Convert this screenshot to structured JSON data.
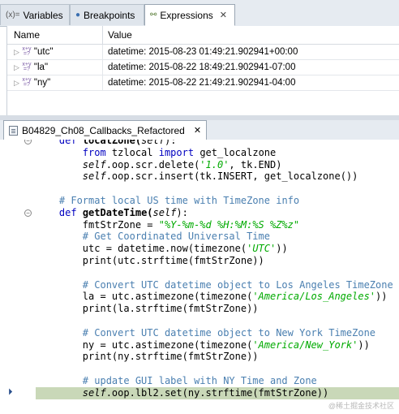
{
  "tabs": [
    {
      "icon": "variables-icon",
      "icon_text": "(x)=",
      "label": "Variables",
      "active": false
    },
    {
      "icon": "breakpoints-icon",
      "icon_text": "●",
      "label": "Breakpoints",
      "active": false
    },
    {
      "icon": "expressions-icon",
      "icon_text": "⚯",
      "label": "Expressions",
      "active": true,
      "close": "✕"
    }
  ],
  "expressions": {
    "columns": {
      "name": "Name",
      "value": "Value"
    },
    "rows": [
      {
        "name": "\"utc\"",
        "value": "datetime: 2015-08-23 01:49:21.902941+00:00"
      },
      {
        "name": "\"la\"",
        "value": "datetime: 2015-08-22 18:49:21.902941-07:00"
      },
      {
        "name": "\"ny\"",
        "value": "datetime: 2015-08-22 21:49:21.902941-04:00"
      }
    ],
    "xy_glyph_top": "x+y",
    "xy_glyph_bottom": "=?"
  },
  "editor": {
    "file_tab": "B04829_Ch08_Callbacks_Refactored",
    "close": "✕",
    "fold_symbol": "⊖",
    "debug_arrow": "⏵",
    "lines": [
      [
        {
          "t": "    "
        },
        {
          "t": "def",
          "c": "kw"
        },
        {
          "t": " localZone(",
          "c": "fn"
        },
        {
          "t": "self",
          "c": "self"
        },
        {
          "t": "):"
        }
      ],
      [
        {
          "t": "        "
        },
        {
          "t": "from",
          "c": "kw"
        },
        {
          "t": " tzlocal "
        },
        {
          "t": "import",
          "c": "kw"
        },
        {
          "t": " get_localzone"
        }
      ],
      [
        {
          "t": "        "
        },
        {
          "t": "self",
          "c": "self"
        },
        {
          "t": ".oop.scr.delete("
        },
        {
          "t": "'1.0'",
          "c": "str"
        },
        {
          "t": ", tk.END)"
        }
      ],
      [
        {
          "t": "        "
        },
        {
          "t": "self",
          "c": "self"
        },
        {
          "t": ".oop.scr.insert(tk.INSERT, get_localzone())"
        }
      ],
      [
        {
          "t": ""
        }
      ],
      [
        {
          "t": "    "
        },
        {
          "t": "# Format local US time with TimeZone info",
          "c": "cm"
        }
      ],
      [
        {
          "t": "    "
        },
        {
          "t": "def",
          "c": "kw"
        },
        {
          "t": " getDateTime(",
          "c": "fn"
        },
        {
          "t": "self",
          "c": "self"
        },
        {
          "t": "):"
        }
      ],
      [
        {
          "t": "        fmtStrZone = "
        },
        {
          "t": "\"%Y-%m-%d %H:%M:%S %Z%z\"",
          "c": "str"
        }
      ],
      [
        {
          "t": "        "
        },
        {
          "t": "# Get Coordinated Universal Time",
          "c": "cm"
        }
      ],
      [
        {
          "t": "        utc = datetime.now(timezone("
        },
        {
          "t": "'UTC'",
          "c": "str"
        },
        {
          "t": "))"
        }
      ],
      [
        {
          "t": "        print(utc.strftime(fmtStrZone))"
        }
      ],
      [
        {
          "t": ""
        }
      ],
      [
        {
          "t": "        "
        },
        {
          "t": "# Convert UTC datetime object to Los Angeles TimeZone",
          "c": "cm"
        }
      ],
      [
        {
          "t": "        la = utc.astimezone(timezone("
        },
        {
          "t": "'America/Los_Angeles'",
          "c": "str"
        },
        {
          "t": "))"
        }
      ],
      [
        {
          "t": "        print(la.strftime(fmtStrZone))"
        }
      ],
      [
        {
          "t": ""
        }
      ],
      [
        {
          "t": "        "
        },
        {
          "t": "# Convert UTC datetime object to New York TimeZone",
          "c": "cm"
        }
      ],
      [
        {
          "t": "        ny = utc.astimezone(timezone("
        },
        {
          "t": "'America/New_York'",
          "c": "str"
        },
        {
          "t": "))"
        }
      ],
      [
        {
          "t": "        print(ny.strftime(fmtStrZone))"
        }
      ],
      [
        {
          "t": ""
        }
      ],
      [
        {
          "t": "        "
        },
        {
          "t": "# update GUI label with NY Time and Zone",
          "c": "cm"
        }
      ],
      [
        {
          "t": "        "
        },
        {
          "t": "self",
          "c": "self"
        },
        {
          "t": ".oop.lbl2.set(ny.strftime(fmtStrZone))"
        }
      ]
    ],
    "current_line": 21,
    "fold_lines": [
      0,
      6
    ]
  },
  "watermark": "@稀土掘金技术社区"
}
